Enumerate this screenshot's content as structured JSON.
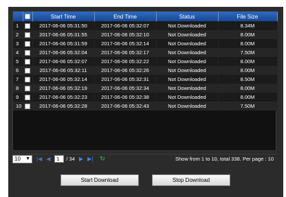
{
  "columns": [
    "Start Time",
    "End Time",
    "Status",
    "File Size"
  ],
  "rows": [
    {
      "num": "1",
      "start": "2017-06-06 05:31:50",
      "end": "2017-06-06 05:32:07",
      "status": "Not Downloaded",
      "size": "8.34M"
    },
    {
      "num": "2",
      "start": "2017-06-06 05:31:55",
      "end": "2017-06-06 05:32:10",
      "status": "Not Downloaded",
      "size": "8.00M"
    },
    {
      "num": "3",
      "start": "2017-06-06 05:31:59",
      "end": "2017-06-06 05:32:14",
      "status": "Not Downloaded",
      "size": "8.00M"
    },
    {
      "num": "4",
      "start": "2017-06-06 05:32:04",
      "end": "2017-06-06 05:32:17",
      "status": "Not Downloaded",
      "size": "7.50M"
    },
    {
      "num": "5",
      "start": "2017-06-06 05:32:07",
      "end": "2017-06-06 05:32:22",
      "status": "Not Downloaded",
      "size": "8.00M"
    },
    {
      "num": "6",
      "start": "2017-06-06 05:32:11",
      "end": "2017-06-06 05:32:26",
      "status": "Not Downloaded",
      "size": "8.00M"
    },
    {
      "num": "7",
      "start": "2017-06-06 05:32:14",
      "end": "2017-06-06 05:32:31",
      "status": "Not Downloaded",
      "size": "8.50M"
    },
    {
      "num": "8",
      "start": "2017-06-06 05:32:19",
      "end": "2017-06-06 05:32:34",
      "status": "Not Downloaded",
      "size": "8.00M"
    },
    {
      "num": "9",
      "start": "2017-06-06 05:32:23",
      "end": "2017-06-06 05:32:38",
      "status": "Not Downloaded",
      "size": "8.00M"
    },
    {
      "num": "10",
      "start": "2017-06-06 05:32:28",
      "end": "2017-06-06 05:32:43",
      "status": "Not Downloaded",
      "size": "7.50M"
    }
  ],
  "pager": {
    "page_size": "10",
    "current_page": "1",
    "total_pages": "/ 34",
    "info": "Show from 1 to 10, total 338. Per page : 10"
  },
  "buttons": {
    "start": "Start Download",
    "stop": "Stop Download"
  },
  "colors": {
    "header_blue": "#2f6bc4",
    "panel": "#2b2b2b"
  }
}
